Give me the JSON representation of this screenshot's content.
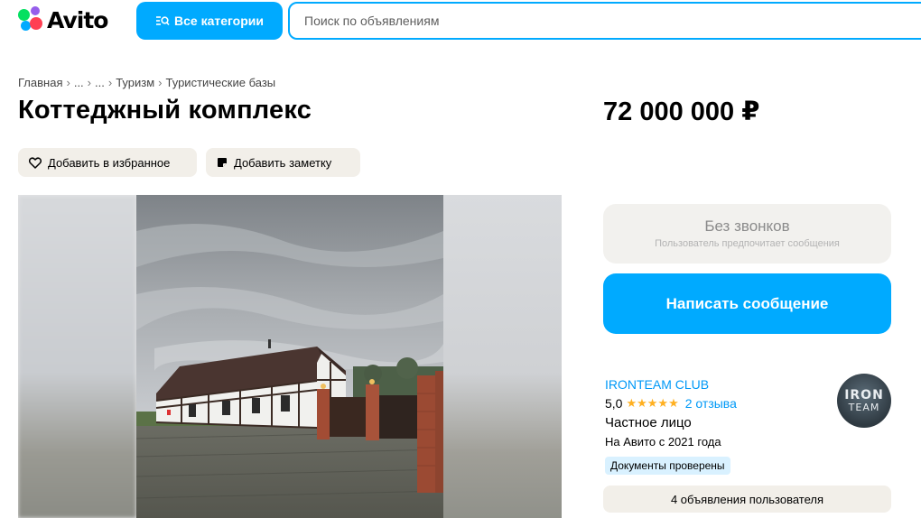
{
  "header": {
    "logo_text": "Avito",
    "categories_label": "Все категории",
    "search_placeholder": "Поиск по объявлениям"
  },
  "breadcrumb": [
    "Главная",
    "...",
    "...",
    "Туризм",
    "Туристические базы"
  ],
  "listing": {
    "title": "Коттеджный комплекс",
    "price": "72 000 000 ₽",
    "favorite_label": "Добавить в избранное",
    "note_label": "Добавить заметку"
  },
  "contact": {
    "no_calls_title": "Без звонков",
    "no_calls_subtitle": "Пользователь предпочитает сообщения",
    "message_label": "Написать сообщение"
  },
  "seller": {
    "name": "IRONTEAM CLUB",
    "rating": "5,0",
    "stars": "★★★★★",
    "reviews": "2 отзыва",
    "type": "Частное лицо",
    "since": "На Авито с 2021 года",
    "verified_badge": "Документы проверены",
    "avatar_line1": "IRON",
    "avatar_line2": "TEAM",
    "ads_label": "4 объявления пользователя"
  },
  "colors": {
    "accent": "#00aaff",
    "link": "#0099f7",
    "star": "#ffb021"
  }
}
